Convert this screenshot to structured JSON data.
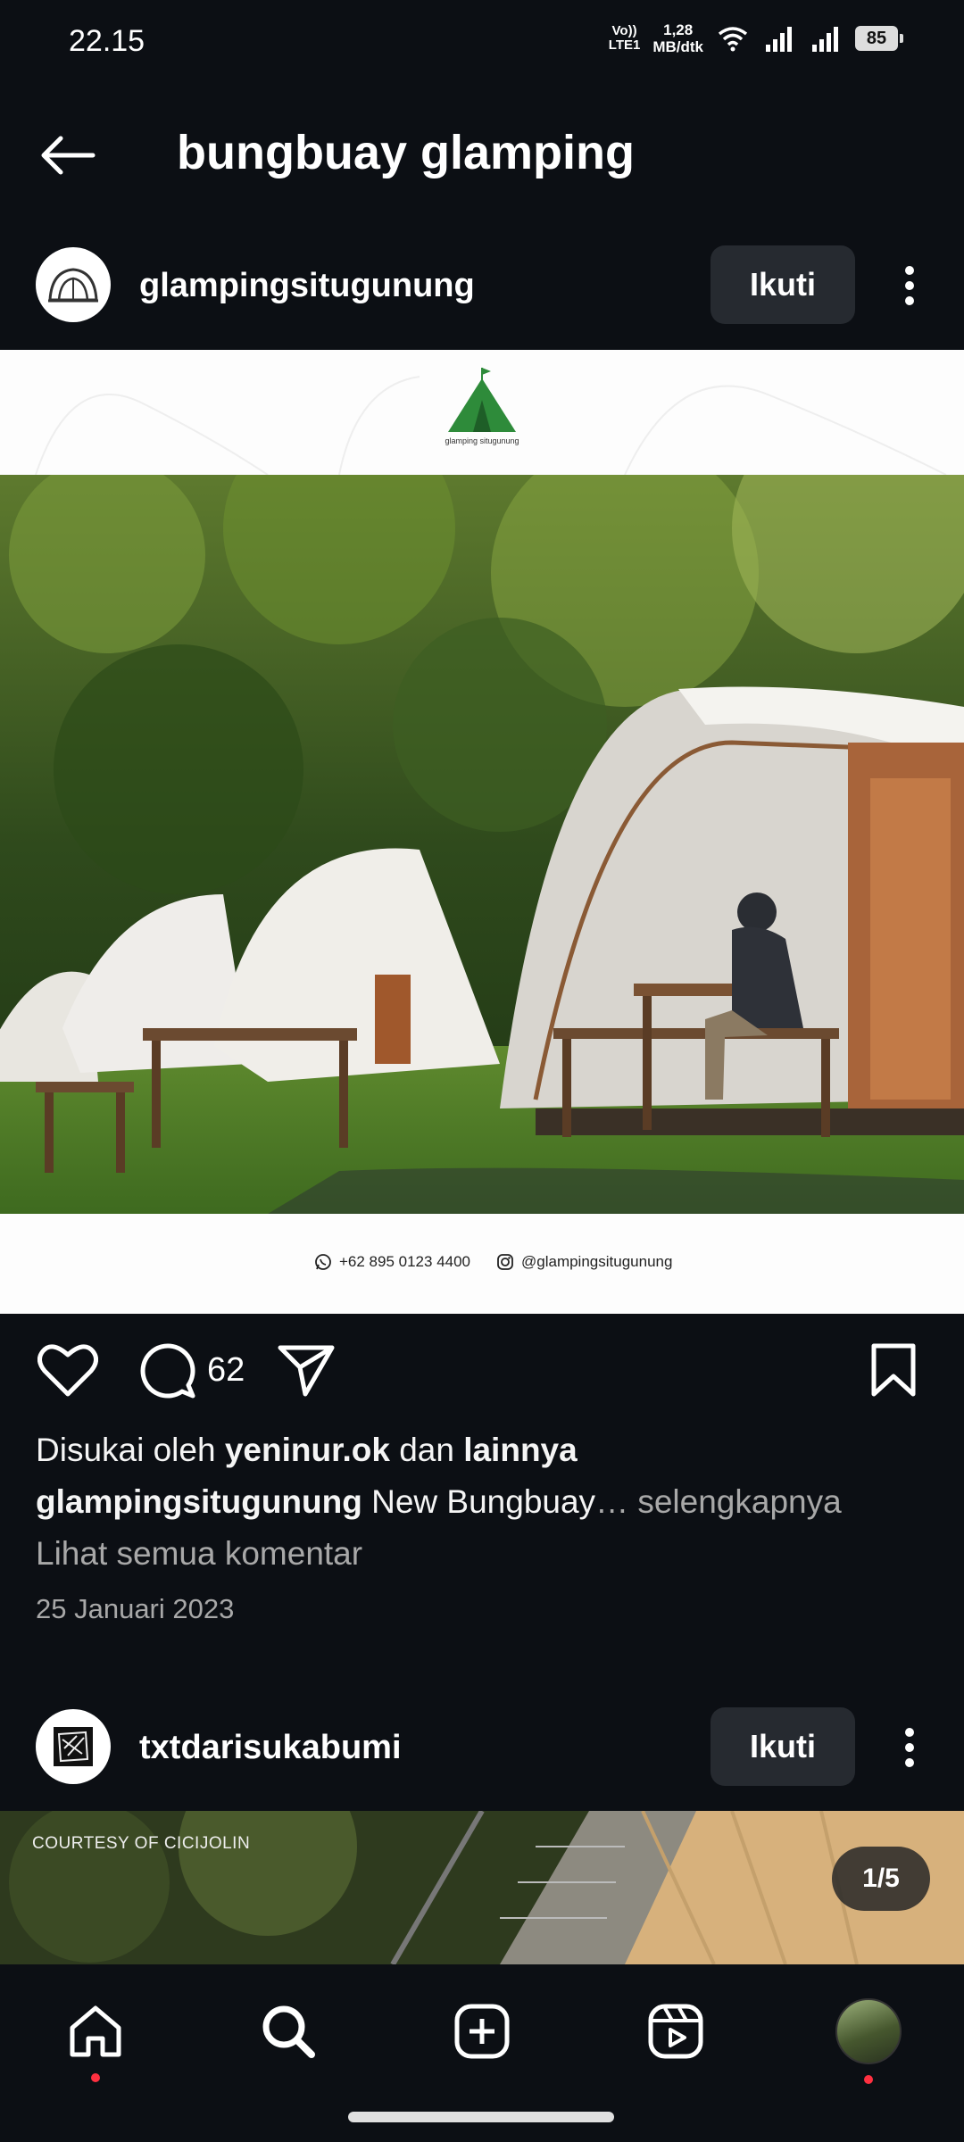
{
  "status_bar": {
    "time": "22.15",
    "network_line1": "Vo))",
    "network_line2": "LTE1",
    "speed_line1": "1,28",
    "speed_line2": "MB/dtk",
    "battery": "85"
  },
  "header": {
    "title": "bungbuay glamping"
  },
  "post1": {
    "username": "glampingsitugunung",
    "follow_label": "Ikuti",
    "logo_caption": "glamping situgunung",
    "phone": "+62 895 0123 4400",
    "instagram_handle": "@glampingsitugunung",
    "comment_count": "62",
    "likes_prefix": "Disukai oleh",
    "likes_user": "yeninur.ok",
    "likes_middle": "dan",
    "likes_others": "lainnya",
    "caption_user": "glampingsitugunung",
    "caption_text": "New Bungbuay",
    "caption_more": "… selengkapnya",
    "view_comments": "Lihat semua komentar",
    "date": "25 Januari 2023"
  },
  "post2": {
    "username": "txtdarisukabumi",
    "follow_label": "Ikuti",
    "courtesy": "COURTESY OF CICIJOLIN",
    "counter": "1/5"
  },
  "colors": {
    "background": "#0c0f14",
    "button_bg": "#262a30",
    "muted_text": "#a8a8a8",
    "notification_dot": "#ff3040",
    "logo_green": "#2e8b3a"
  },
  "icons": {
    "back": "arrow-left-icon",
    "more": "more-vertical-icon",
    "like": "heart-icon",
    "comment": "comment-icon",
    "share": "send-icon",
    "save": "bookmark-icon",
    "home": "home-icon",
    "search": "search-icon",
    "create": "plus-square-icon",
    "reels": "reels-icon"
  }
}
